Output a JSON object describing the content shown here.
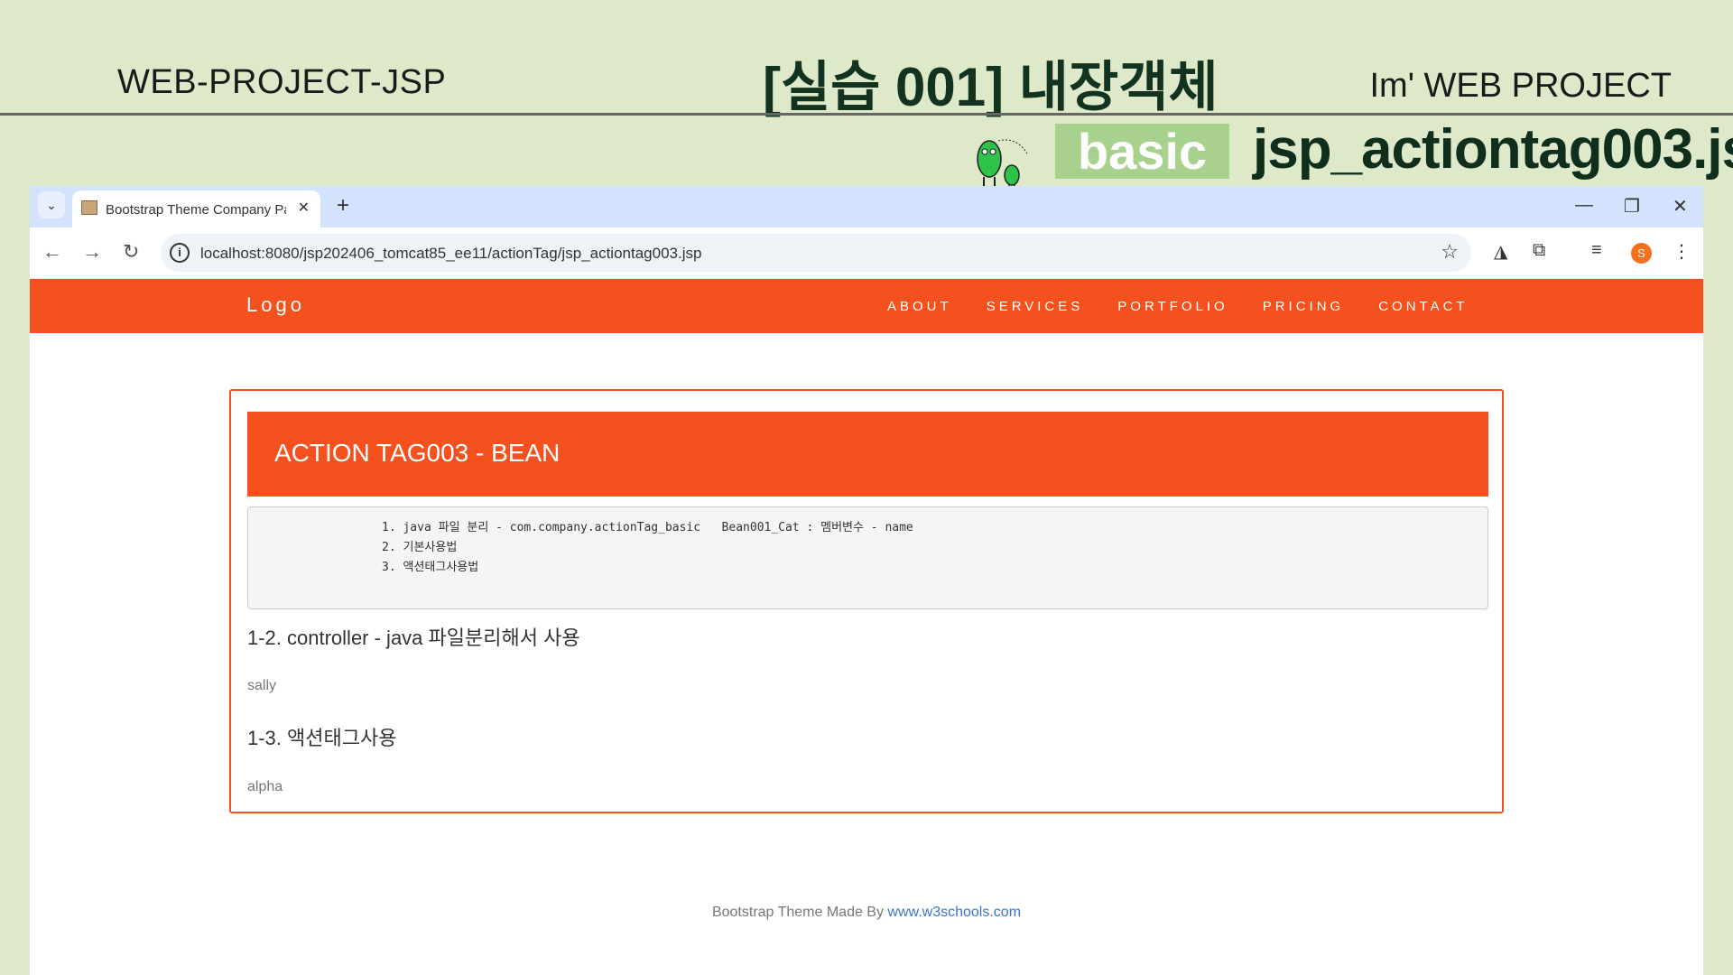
{
  "slide": {
    "left_title": "WEB-PROJECT-JSP",
    "center_title": "[실습 001] 내장객체",
    "right_title": "Im' WEB PROJECT",
    "badge": "basic",
    "file_title": "jsp_actiontag003.jsp"
  },
  "browser": {
    "tab_title": "Bootstrap Theme Company Pa",
    "url": "localhost:8080/jsp202406_tomcat85_ee11/actionTag/jsp_actiontag003.jsp",
    "profile_initial": "S"
  },
  "site": {
    "logo": "Logo",
    "nav": [
      "ABOUT",
      "SERVICES",
      "PORTFOLIO",
      "PRICING",
      "CONTACT"
    ],
    "panel_title": "ACTION TAG003 - BEAN",
    "pre_lines": [
      "1. java 파일 분리 - com.company.actionTag_basic   Bean001_Cat : 멤버변수 - name",
      "2. 기본사용법",
      "3. 액션태그사용법"
    ],
    "section1_title": "1-2. controller - java 파일분리해서 사용",
    "section1_value": "sally",
    "section2_title": "1-3. 액션태그사용",
    "section2_value": "alpha",
    "footer_text": "Bootstrap Theme Made By ",
    "footer_link": "www.w3schools.com"
  }
}
